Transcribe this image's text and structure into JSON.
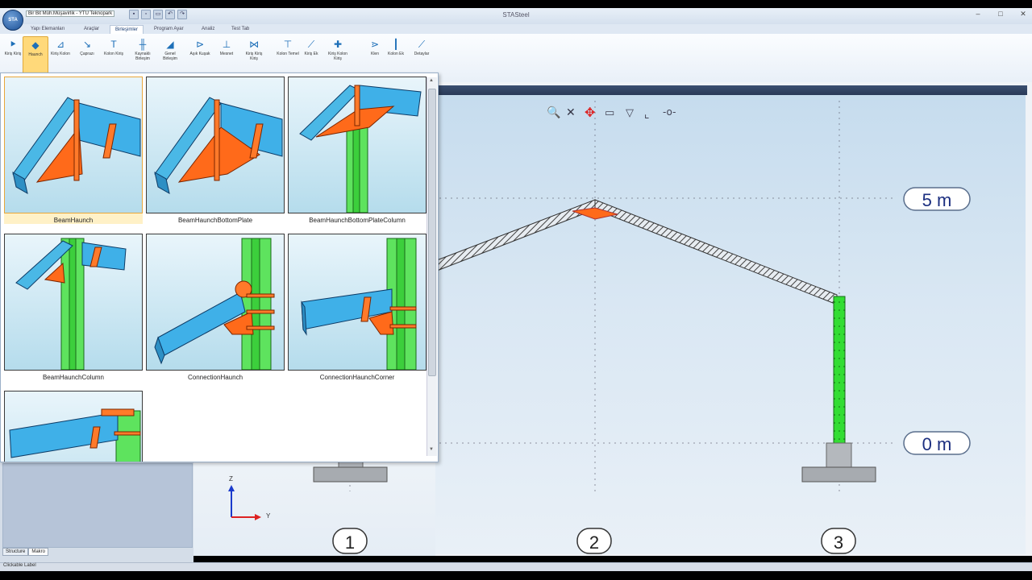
{
  "titlebar": {
    "doc_title": "Bir Bit Müh.Müşavirlik - YTU Teknopark",
    "app_title": "STASteel",
    "controls": [
      "–",
      "□",
      "✕"
    ]
  },
  "tabs": [
    "Yapı Elemanları",
    "Araçlar",
    "Birleşimler",
    "Program Ayar",
    "Analiz",
    "Test Tab"
  ],
  "active_tab": "Birleşimler",
  "ribbon": [
    {
      "label": "Kiriş Kiriş",
      "icon": "beam-beam-icon"
    },
    {
      "label": "Haunch",
      "icon": "haunch-icon"
    },
    {
      "label": "Kiriş Kolon",
      "icon": "beam-column-icon"
    },
    {
      "label": "Çaprazı",
      "icon": "brace-icon"
    },
    {
      "label": "Kolon Kiriş",
      "icon": "column-beam-icon"
    },
    {
      "label": "Kaynaklı Birleşim",
      "icon": "welded-icon"
    },
    {
      "label": "Genel Birleşim",
      "icon": "general-icon"
    },
    {
      "label": "Aşık Kuşak",
      "icon": "purlin-icon"
    },
    {
      "label": "Mesnet",
      "icon": "support-icon"
    },
    {
      "label": "Kiriş Kiriş Kiriş",
      "icon": "beam3-icon"
    },
    {
      "label": "Kolon Temel",
      "icon": "column-base-icon"
    },
    {
      "label": "Kiriş Ek",
      "icon": "beam-splice-icon"
    },
    {
      "label": "Kiriş Kolon Kiriş",
      "icon": "beam-column-beam-icon"
    },
    {
      "label": "Klen",
      "icon": "cleat-icon"
    },
    {
      "label": "Kolon Ek",
      "icon": "column-splice-icon"
    },
    {
      "label": "Detaylar",
      "icon": "details-icon"
    }
  ],
  "gallery": {
    "items": [
      {
        "label": "BeamHaunch",
        "selected": true
      },
      {
        "label": "BeamHaunchBottomPlate",
        "selected": false
      },
      {
        "label": "BeamHaunchBottomPlateColumn",
        "selected": false
      },
      {
        "label": "BeamHaunchColumn",
        "selected": false
      },
      {
        "label": "ConnectionHaunch",
        "selected": false
      },
      {
        "label": "ConnectionHaunchCorner",
        "selected": false
      },
      {
        "label": "",
        "selected": false
      }
    ]
  },
  "left_panel": {
    "tabs": [
      "Structure",
      "Makro"
    ],
    "active": "Makro"
  },
  "viewport": {
    "levels": [
      "5 m",
      "0 m"
    ],
    "grid_axes": [
      "1",
      "2",
      "3"
    ],
    "axis_labels": {
      "z": "Z",
      "y": "Y"
    },
    "colors": {
      "beam": "#b9c3ce",
      "column": "#33dd33",
      "plate": "#ff6a1a",
      "background": "#dde9f3"
    }
  },
  "statusbar": {
    "text": "Clickable Label"
  }
}
